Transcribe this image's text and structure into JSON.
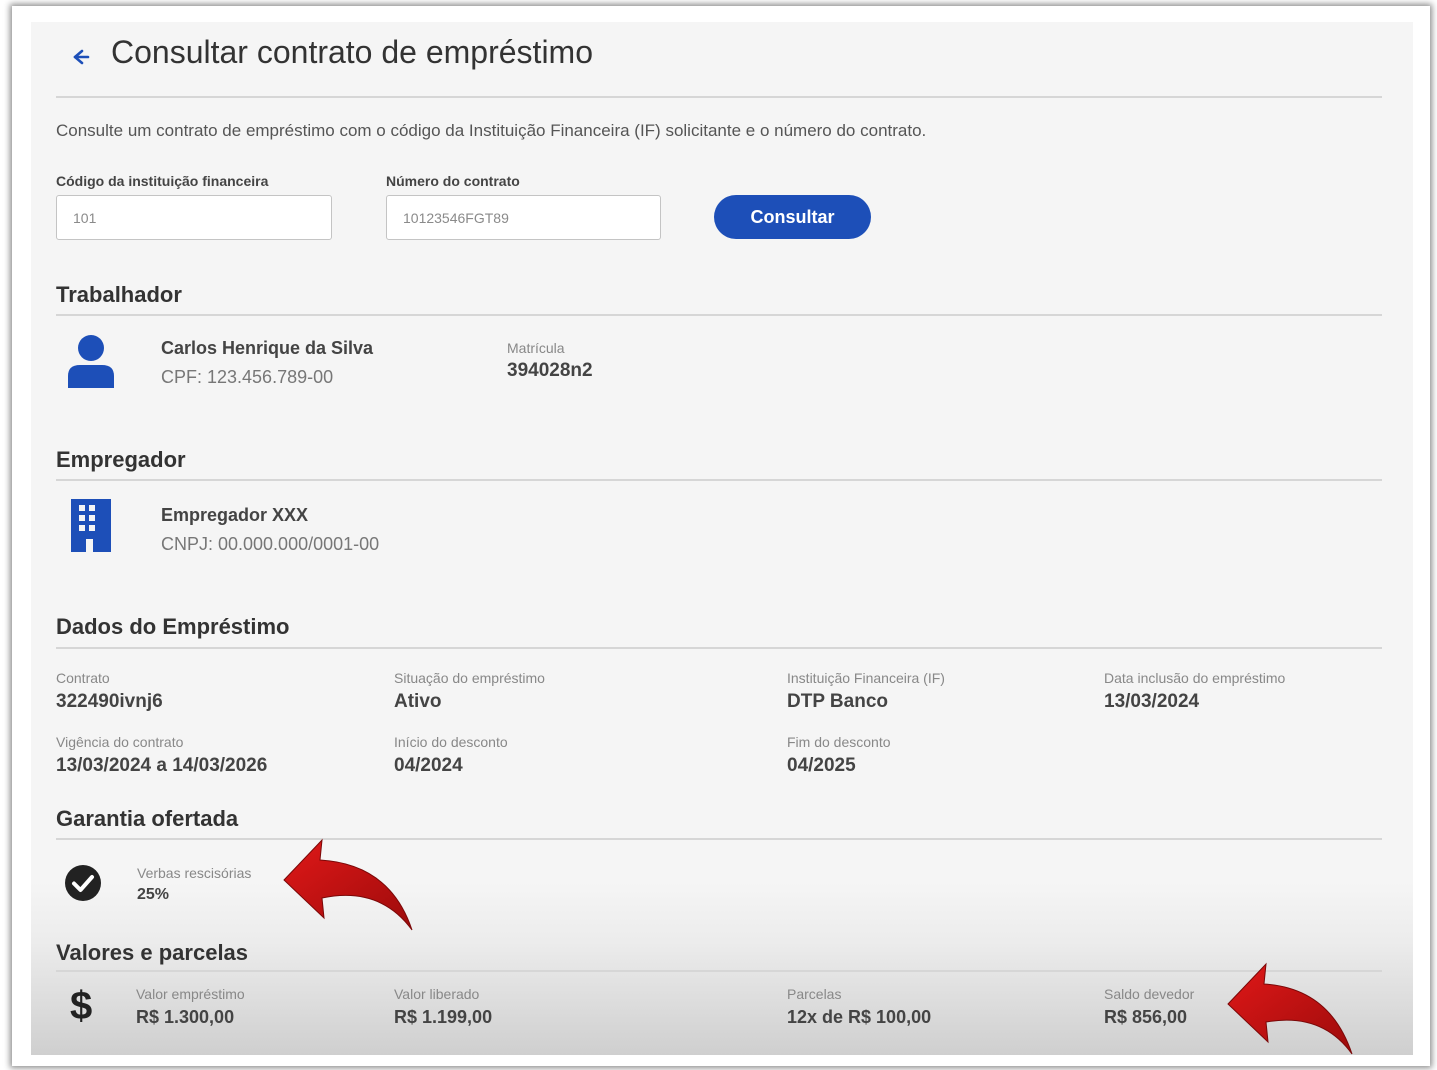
{
  "header": {
    "title": "Consultar contrato de empréstimo",
    "intro": "Consulte um contrato de empréstimo com o código da Instituição Financeira (IF) solicitante e o número do contrato."
  },
  "form": {
    "institution_label": "Código da instituição financeira",
    "institution_value": "101",
    "contract_label": "Número do contrato",
    "contract_value": "10123546FGT89",
    "submit_label": "Consultar"
  },
  "worker": {
    "section_title": "Trabalhador",
    "name": "Carlos Henrique da Silva",
    "cpf": "CPF: 123.456.789-00",
    "registration_label": "Matrícula",
    "registration_value": "394028n2"
  },
  "employer": {
    "section_title": "Empregador",
    "name": "Empregador XXX",
    "cnpj": "CNPJ: 00.000.000/0001-00"
  },
  "loan": {
    "section_title": "Dados do Empréstimo",
    "fields": [
      {
        "label": "Contrato",
        "value": "322490ivnj6"
      },
      {
        "label": "Situação do empréstimo",
        "value": "Ativo"
      },
      {
        "label": "Instituição Financeira (IF)",
        "value": "DTP Banco"
      },
      {
        "label": "Data inclusão do empréstimo",
        "value": "13/03/2024"
      },
      {
        "label": "Vigência do contrato",
        "value": "13/03/2024 a 14/03/2026"
      },
      {
        "label": "Início do desconto",
        "value": "04/2024"
      },
      {
        "label": "Fim do desconto",
        "value": "04/2025"
      }
    ]
  },
  "guarantee": {
    "section_title": "Garantia ofertada",
    "label": "Verbas rescisórias",
    "value": "25%"
  },
  "values": {
    "section_title": "Valores e parcelas",
    "fields": [
      {
        "label": "Valor empréstimo",
        "value": "R$ 1.300,00"
      },
      {
        "label": "Valor liberado",
        "value": "R$ 1.199,00"
      },
      {
        "label": "Parcelas",
        "value": "12x de R$ 100,00"
      },
      {
        "label": "Saldo devedor",
        "value": "R$ 856,00"
      }
    ]
  },
  "colors": {
    "accent": "#1d4fb8",
    "annotation_arrow": "#d11414"
  },
  "icons": {
    "back": "arrow-left-icon",
    "worker": "person-icon",
    "employer": "building-icon",
    "guarantee": "check-circle-icon",
    "values": "dollar-icon"
  }
}
